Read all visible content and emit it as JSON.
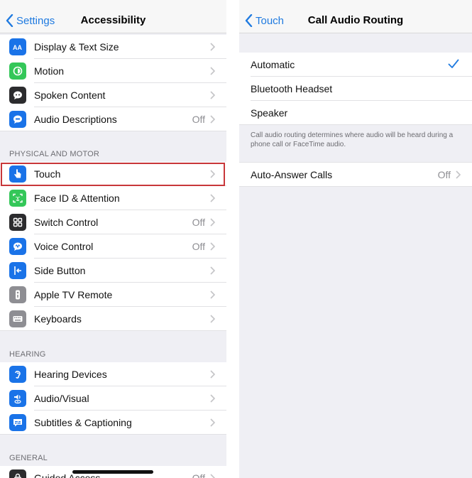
{
  "left": {
    "back_label": "Settings",
    "title": "Accessibility",
    "top_rows": [
      {
        "label": "Display & Text Size",
        "value": "",
        "icon": "text-size-icon",
        "color": "#1a73e8"
      },
      {
        "label": "Motion",
        "value": "",
        "icon": "motion-icon",
        "color": "#34c759"
      },
      {
        "label": "Spoken Content",
        "value": "",
        "icon": "speech-bubble-icon",
        "color": "#2c2c2e"
      },
      {
        "label": "Audio Descriptions",
        "value": "Off",
        "icon": "audio-description-icon",
        "color": "#1a73e8"
      }
    ],
    "section_physical": "PHYSICAL AND MOTOR",
    "physical_rows": [
      {
        "label": "Touch",
        "value": "",
        "icon": "hand-pointer-icon",
        "color": "#1a73e8"
      },
      {
        "label": "Face ID & Attention",
        "value": "",
        "icon": "face-id-icon",
        "color": "#34c759"
      },
      {
        "label": "Switch Control",
        "value": "Off",
        "icon": "switch-grid-icon",
        "color": "#2c2c2e"
      },
      {
        "label": "Voice Control",
        "value": "Off",
        "icon": "voice-control-icon",
        "color": "#1a73e8"
      },
      {
        "label": "Side Button",
        "value": "",
        "icon": "side-button-icon",
        "color": "#1a73e8"
      },
      {
        "label": "Apple TV Remote",
        "value": "",
        "icon": "remote-icon",
        "color": "#8e8e93"
      },
      {
        "label": "Keyboards",
        "value": "",
        "icon": "keyboard-icon",
        "color": "#8e8e93"
      }
    ],
    "section_hearing": "HEARING",
    "hearing_rows": [
      {
        "label": "Hearing Devices",
        "value": "",
        "icon": "ear-icon",
        "color": "#1a73e8"
      },
      {
        "label": "Audio/Visual",
        "value": "",
        "icon": "audio-visual-icon",
        "color": "#1a73e8"
      },
      {
        "label": "Subtitles & Captioning",
        "value": "",
        "icon": "captions-icon",
        "color": "#1a73e8"
      }
    ],
    "section_general": "GENERAL",
    "general_rows": [
      {
        "label": "Guided Access",
        "value": "Off",
        "icon": "lock-icon",
        "color": "#2c2c2e"
      }
    ]
  },
  "right": {
    "back_label": "Touch",
    "title": "Call Audio Routing",
    "routing_options": [
      {
        "label": "Automatic",
        "selected": true
      },
      {
        "label": "Bluetooth Headset",
        "selected": false
      },
      {
        "label": "Speaker",
        "selected": false
      }
    ],
    "footnote": "Call audio routing determines where audio will be heard during a phone call or FaceTime audio.",
    "auto_answer": {
      "label": "Auto-Answer Calls",
      "value": "Off"
    }
  },
  "colors": {
    "accent": "#1f7ae0",
    "highlight": "#c8373a"
  }
}
